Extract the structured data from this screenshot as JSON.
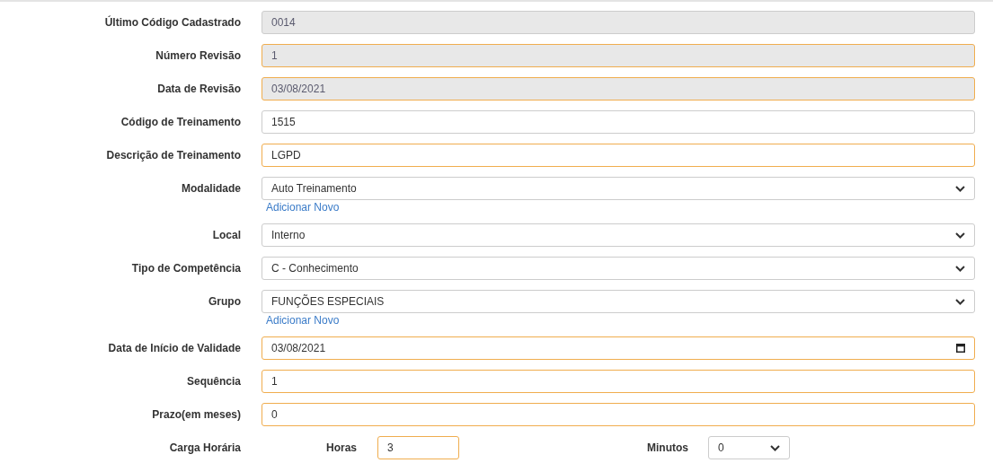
{
  "fields": [
    {
      "label": "Último Código Cadastrado",
      "kind": "input",
      "value": "0014",
      "disabled": true,
      "highlighted": false
    },
    {
      "label": "Número Revisão",
      "kind": "input",
      "value": "1",
      "disabled": true,
      "highlighted": true
    },
    {
      "label": "Data de Revisão",
      "kind": "input",
      "value": "03/08/2021",
      "disabled": true,
      "highlighted": true
    },
    {
      "label": "Código de Treinamento",
      "kind": "input",
      "value": "1515",
      "disabled": false,
      "highlighted": false
    },
    {
      "label": "Descrição de Treinamento",
      "kind": "input",
      "value": "LGPD",
      "disabled": false,
      "highlighted": true
    },
    {
      "label": "Modalidade",
      "kind": "select",
      "value": "Auto Treinamento",
      "disabled": false,
      "highlighted": false,
      "link": "Adicionar Novo"
    },
    {
      "label": "Local",
      "kind": "select",
      "value": "Interno",
      "disabled": false,
      "highlighted": false
    },
    {
      "label": "Tipo de Competência",
      "kind": "select",
      "value": "C - Conhecimento",
      "disabled": false,
      "highlighted": false
    },
    {
      "label": "Grupo",
      "kind": "select",
      "value": "FUNÇÕES ESPECIAIS",
      "disabled": false,
      "highlighted": false,
      "link": "Adicionar Novo"
    },
    {
      "label": "Data de Início de Validade",
      "kind": "date",
      "value": "03/08/2021",
      "disabled": false,
      "highlighted": true
    },
    {
      "label": "Sequência",
      "kind": "input",
      "value": "1",
      "disabled": false,
      "highlighted": true
    },
    {
      "label": "Prazo(em meses)",
      "kind": "input",
      "value": "0",
      "disabled": false,
      "highlighted": true
    }
  ],
  "workload": {
    "label": "Carga Horária",
    "hours": {
      "label": "Horas",
      "value": "3",
      "highlighted": true
    },
    "minutes": {
      "label": "Minutos",
      "value": "0",
      "highlighted": false
    }
  }
}
